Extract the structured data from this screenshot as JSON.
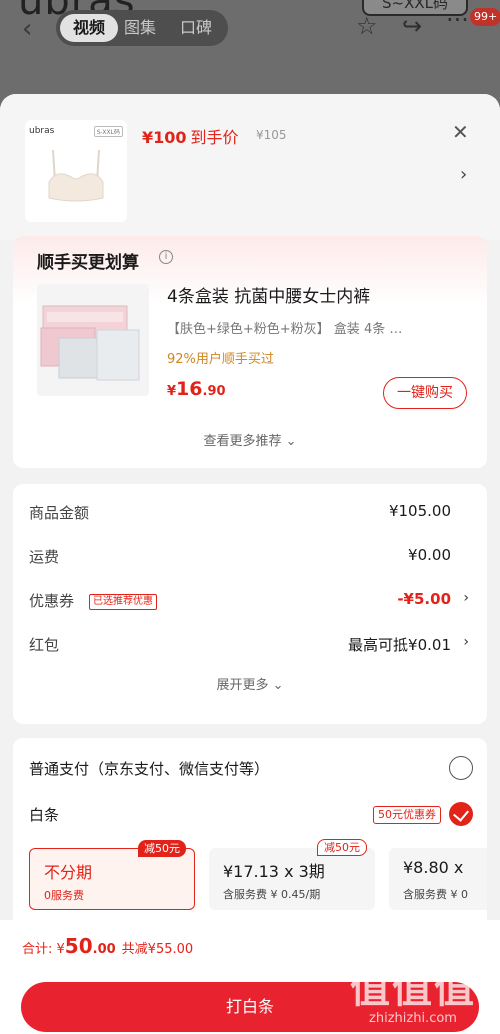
{
  "background": {
    "brand_fragment": "ubras",
    "size_badge": "S~XXL码",
    "tabs": [
      "视频",
      "图集",
      "口碑"
    ],
    "badge_count": "99+"
  },
  "product_header": {
    "thumb_brand": "ubras",
    "thumb_size": "S-XXL码",
    "price": "¥100",
    "price_tag": "到手价",
    "orig_price": "¥105"
  },
  "recommend": {
    "title": "顺手买更划算",
    "item_name": "4条盒装 抗菌中腰女士内裤",
    "spec": "【肤色+绿色+粉色+粉灰】 盒装 4条 …",
    "pct_text": "92%用户顺手买过",
    "price_yen": "¥",
    "price_int": "16",
    "price_dec": ".90",
    "buy_label": "一键购买",
    "more_label": "查看更多推荐 ⌄"
  },
  "summary": {
    "rows": [
      {
        "label": "商品金额",
        "value": "¥105.00"
      },
      {
        "label": "运费",
        "value": "¥0.00"
      },
      {
        "label": "优惠券",
        "tag": "已选推荐优惠",
        "value": "-¥5.00"
      },
      {
        "label": "红包",
        "value": "最高可抵¥0.01"
      }
    ],
    "expand_label": "展开更多 ⌄"
  },
  "payment": {
    "normal_label": "普通支付（京东支付、微信支付等）",
    "baitiao_label": "白条",
    "baitiao_promo": "50元优惠券",
    "installments": [
      {
        "t1": "不分期",
        "t2": "0服务费",
        "badge": "减50元"
      },
      {
        "t1": "¥17.13 x 3期",
        "t2": "含服务费 ¥ 0.45/期",
        "badge": "减50元"
      },
      {
        "t1": "¥8.80 x",
        "t2": "含服务费 ¥ 0"
      }
    ]
  },
  "footer": {
    "total_label": "合计: ¥",
    "total_int": "50",
    "total_dec": ".00",
    "discount": "共减¥55.00",
    "pay_button": "打白条"
  },
  "watermark": {
    "logo": "值值值",
    "url": "zhizhizhi.com"
  },
  "colors": {
    "accent": "#e2231a",
    "button": "#e8232f"
  }
}
